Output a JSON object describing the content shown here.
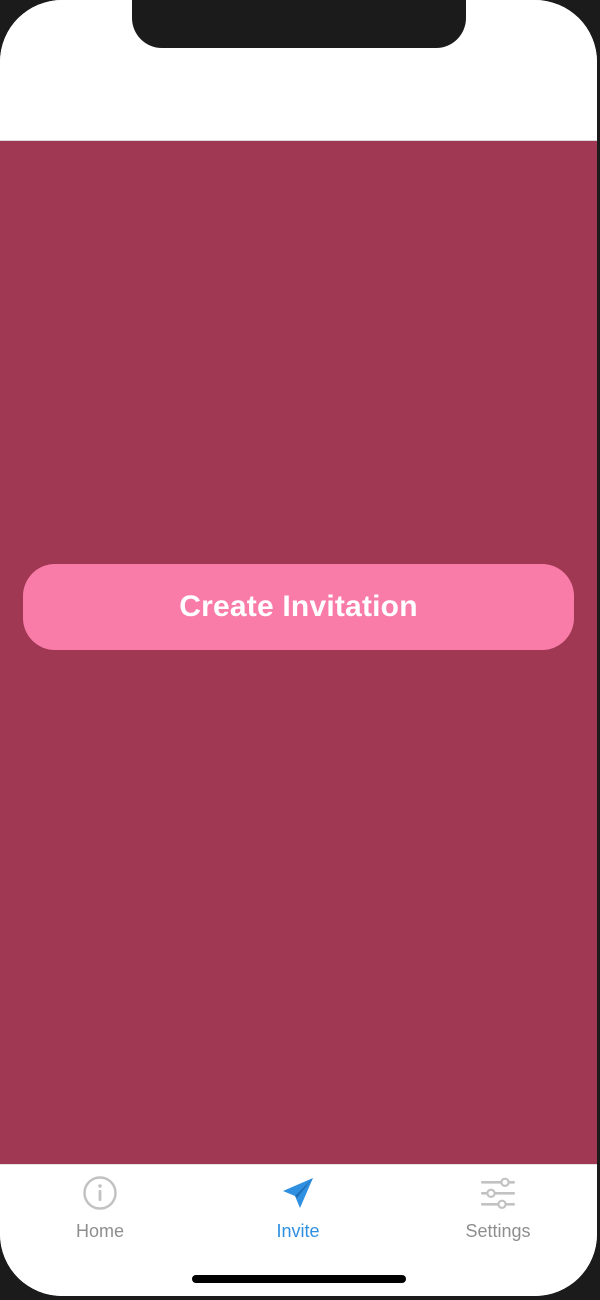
{
  "main": {
    "cta_label": "Create Invitation"
  },
  "tabbar": {
    "items": [
      {
        "label": "Home",
        "icon": "info-icon",
        "active": false
      },
      {
        "label": "Invite",
        "icon": "paper-plane-icon",
        "active": true
      },
      {
        "label": "Settings",
        "icon": "sliders-icon",
        "active": false
      }
    ]
  },
  "colors": {
    "background": "#a03854",
    "button": "#f97ca8",
    "active_tab": "#2f8fe0",
    "inactive_tab": "#8e8e8e"
  }
}
